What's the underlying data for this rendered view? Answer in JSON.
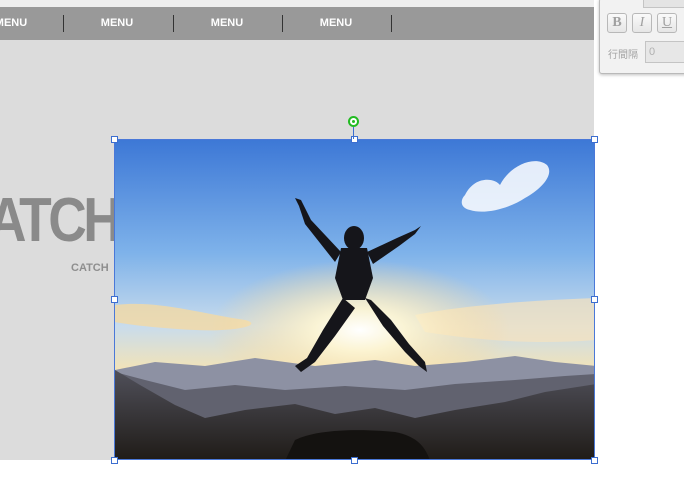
{
  "menu": {
    "items": [
      {
        "label": "MENU"
      },
      {
        "label": "MENU"
      },
      {
        "label": "MENU"
      },
      {
        "label": "MENU"
      }
    ]
  },
  "hero": {
    "catch_big": "ATCH",
    "catch_small": "CATCH"
  },
  "image": {
    "description_icon": "photo-jumping-person-icon"
  },
  "format_panel": {
    "bold_label": "B",
    "italic_label": "I",
    "underline_label": "U",
    "line_spacing_label": "行間隔",
    "line_spacing_value": "0"
  },
  "colors": {
    "selection": "#4a78d8",
    "rotate_handle": "#22bb22",
    "menu_bar": "#999999",
    "canvas_bg": "#dcdcdc"
  }
}
